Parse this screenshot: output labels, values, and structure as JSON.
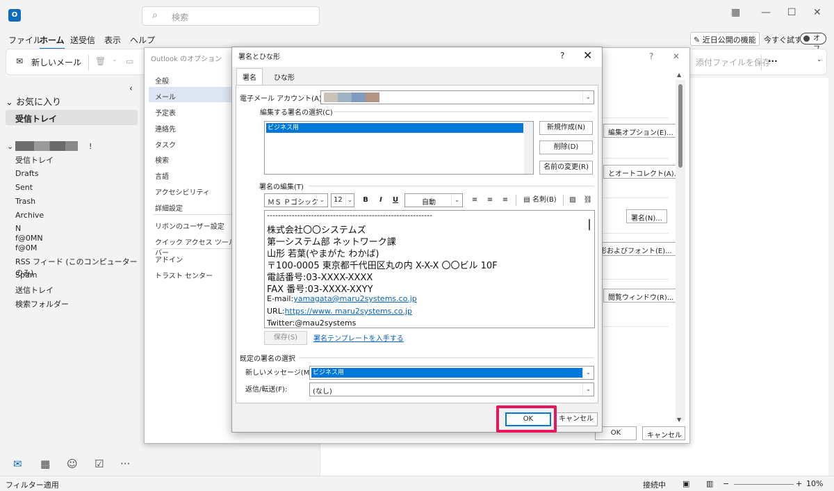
{
  "outlook": {
    "search_placeholder": "検索",
    "menu": [
      "ファイル",
      "ホーム",
      "送受信",
      "表示",
      "ヘルプ"
    ],
    "feature_button": "近日公開の機能",
    "try_now": "今すぐ試す",
    "toggle_label": "オフ",
    "ribbon": {
      "new_mail": "新しいメール",
      "save_attachment": "添付ファイルを保存",
      "more": "···"
    },
    "folders": {
      "favorites": "お気に入り",
      "fav_inbox": "受信トレイ",
      "account_suffix": "!",
      "items": [
        "受信トレイ",
        "Drafts",
        "Sent",
        "Trash",
        "Archive",
        "N",
        "f@0MN",
        "f@0M",
        "RSS フィード (このコンピューターのみ)",
        "Spam",
        "送信トレイ",
        "検索フォルダー"
      ]
    },
    "status": {
      "filter": "フィルター適用",
      "connection": "接続中",
      "zoom": "10%"
    }
  },
  "options_dialog": {
    "title": "Outlook のオプション",
    "help": "?",
    "close": "✕",
    "nav": [
      "全般",
      "メール",
      "予定表",
      "連絡先",
      "タスク",
      "検索",
      "言語",
      "アクセシビリティ",
      "詳細設定",
      "リボンのユーザー設定",
      "クイック アクセス ツール バー",
      "アドイン",
      "トラスト センター"
    ],
    "buttons": {
      "editor_options": "編集オプション(E)...",
      "autocorrect": "とオートコレクト(A)...",
      "signature": "署名(N)...",
      "stationery": "形およびフォント(E)...",
      "reading_pane": "閲覧ウィンドウ(R)...",
      "ok": "OK",
      "cancel": "キャンセル"
    }
  },
  "signature_dialog": {
    "title": "署名とひな形",
    "help": "?",
    "close": "✕",
    "tabs": [
      "署名",
      "ひな形"
    ],
    "email_account_label": "電子メール アカウント(A):",
    "select_group_label": "編集する署名の選択(C)",
    "signatures": [
      "ビジネス用"
    ],
    "btn_new": "新規作成(N)",
    "btn_delete": "削除(D)",
    "btn_rename": "名前の変更(R)",
    "edit_group_label": "署名の編集(T)",
    "font_name": "ＭＳ Ｐゴシック",
    "font_size": "12",
    "bold": "B",
    "italic": "I",
    "underline": "U",
    "color": "自動",
    "business_card": "名刺(B)",
    "signature_lines": [
      "------------------------------------------------------------",
      "株式会社〇〇システムズ",
      "第一システム部 ネットワーク課",
      "山形 若葉(やまがた わかば)",
      "〒100-0005 東京都千代田区丸の内 X-X-X 〇〇ビル 10F",
      "電話番号:03-XXXX-XXXX",
      "FAX 番号:03-XXXX-XXYY"
    ],
    "email_prefix": "E-mail:",
    "email": "yamagata@maru2systems.co.jp",
    "url_prefix": "URL:",
    "url": "https://www. maru2systems.co.jp",
    "twitter": "Twitter:@mau2systems",
    "btn_save": "保存(S)",
    "template_link": "署名テンプレートを入手する",
    "default_group_label": "既定の署名の選択",
    "new_messages_label": "新しいメッセージ(M):",
    "new_messages_value": "ビジネス用",
    "reply_label": "返信/転送(F):",
    "reply_value": "(なし)",
    "btn_ok": "OK",
    "btn_cancel": "キャンセル"
  },
  "colors": {
    "accent": "#0f6cbd",
    "highlight": "#e8175d",
    "selection": "#0078d7"
  }
}
